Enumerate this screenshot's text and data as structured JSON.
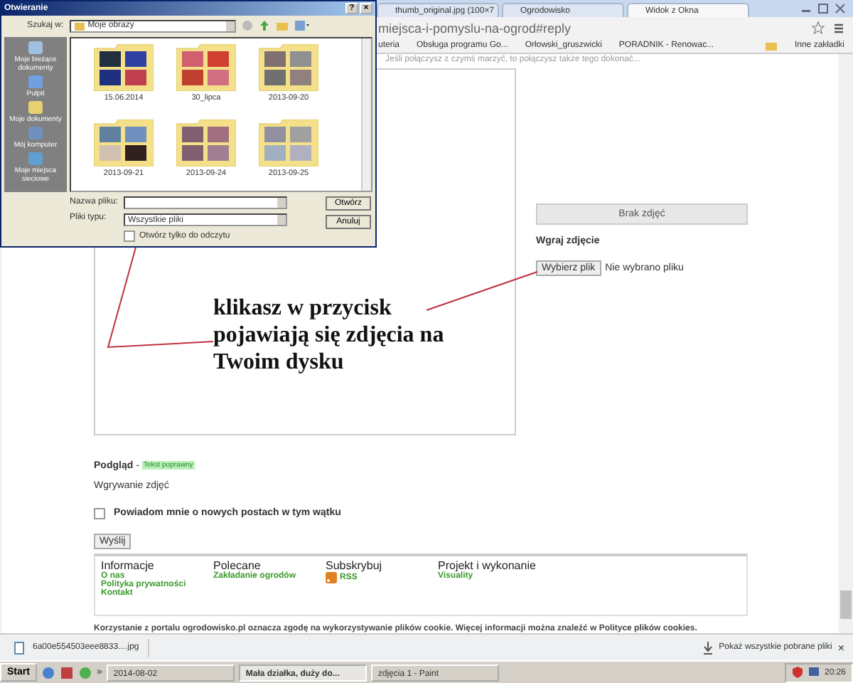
{
  "browser": {
    "tabs": [
      {
        "label": "thumb_original.jpg (100×7",
        "selected": false
      },
      {
        "label": "Ogrodowisko",
        "selected": false
      },
      {
        "label": "Widok z Okna",
        "selected": true
      }
    ],
    "address": "miejsca-i-pomyslu-na-ogrod#reply",
    "bookmarks": [
      "uteria",
      "Obsługa programu Go...",
      "Orłowski_gruszwicki",
      "PORADNIK - Renowac..."
    ],
    "other_bookmarks": "Inne zakładki"
  },
  "page": {
    "intro": "Jeśli połączysz z czymś marzyć, to połączysz także tego dokonać...",
    "no_photos_button": "Brak zdjęć",
    "upload_heading": "Wgraj zdjęcie",
    "choose_file_button": "Wybierz plik",
    "no_file": "Nie wybrano pliku",
    "annotation": [
      "klikasz w przycisk",
      "pojawiają się zdjęcia na",
      "Twoim dysku"
    ],
    "preview_label": "Podgląd",
    "preview_separator": "-",
    "preview_badge": "Tekst poprawny",
    "uploading": "Wgrywanie zdjęć",
    "notify": {
      "label": "Powiadom mnie o nowych postach w tym wątku",
      "checked": false
    },
    "send_button": "Wyślij",
    "footer": [
      {
        "heading": "Informacje",
        "kind": "links",
        "links": [
          "O nas",
          "Polityka prywatności",
          "Kontakt"
        ]
      },
      {
        "heading": "Polecane",
        "kind": "links",
        "links": [
          "Zakładanie ogrodów"
        ]
      },
      {
        "heading": "Subskrybuj",
        "kind": "feed",
        "links": [
          "RSS"
        ]
      },
      {
        "heading": "Projekt i wykonanie",
        "kind": "links",
        "links": [
          "Visuality"
        ]
      }
    ],
    "cookie_notice": "Korzystanie z portalu ogrodowisko.pl oznacza zgodę na wykorzystywanie plików cookie. Więcej informacji można znaleźć w Polityce plików cookies."
  },
  "downloads": {
    "file": "6a00e554503eee8833....jpg",
    "show_all": "Pokaż wszystkie pobrane pliki",
    "close": "×"
  },
  "dialog": {
    "title": "Otwieranie",
    "help": "?",
    "close": "×",
    "look_in_label": "Szukaj w:",
    "look_in": "Moje obrazy",
    "places": [
      "Moje bieżące dokumenty",
      "Pulpit",
      "Moje dokumenty",
      "Mój komputer",
      "Moje miejsca sieciowe"
    ],
    "folders": [
      "15.06.2014",
      "30_lipca",
      "2013-09-20",
      "2013-09-21",
      "2013-09-24",
      "2013-09-25"
    ],
    "file_name_label": "Nazwa pliku:",
    "file_type_label": "Pliki typu:",
    "file_type": "Wszystkie pliki",
    "open_button": "Otwórz",
    "cancel_button": "Anuluj",
    "read_only": {
      "label": "Otwórz tylko do odczytu",
      "checked": false
    }
  },
  "taskbar": {
    "start": "Start",
    "more": "»",
    "items": [
      {
        "label": "2014-08-02",
        "selected": false
      },
      {
        "label": "Mała działka, duży do...",
        "selected": true
      },
      {
        "label": "zdjęcia 1 - Paint",
        "selected": false
      }
    ],
    "clock": "20:26"
  }
}
